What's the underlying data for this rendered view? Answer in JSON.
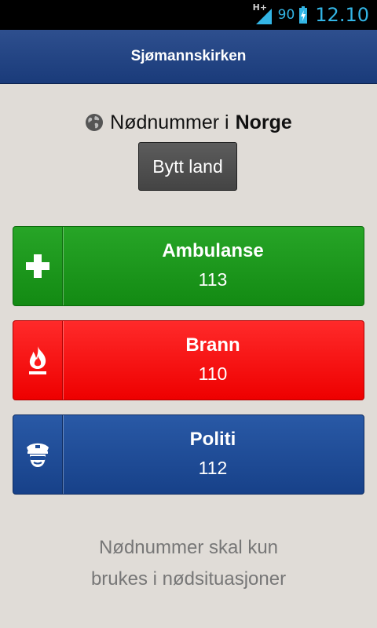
{
  "status_bar": {
    "network_type": "H+",
    "battery_percent": "90",
    "time": "12.10",
    "accent_color": "#33b5e5"
  },
  "header": {
    "title": "Sjømannskirken"
  },
  "country": {
    "prefix": "Nødnummer i",
    "name": "Norge",
    "icon": "globe-icon",
    "switch_label": "Bytt land"
  },
  "emergency": [
    {
      "name": "Ambulanse",
      "number": "113",
      "icon": "plus-icon",
      "color": "#1f9a1f"
    },
    {
      "name": "Brann",
      "number": "110",
      "icon": "fire-icon",
      "color": "#ff0000"
    },
    {
      "name": "Politi",
      "number": "112",
      "icon": "police-icon",
      "color": "#1f4d99"
    }
  ],
  "note": {
    "line1": "Nødnummer skal kun",
    "line2": "brukes i nødsituasjoner"
  }
}
